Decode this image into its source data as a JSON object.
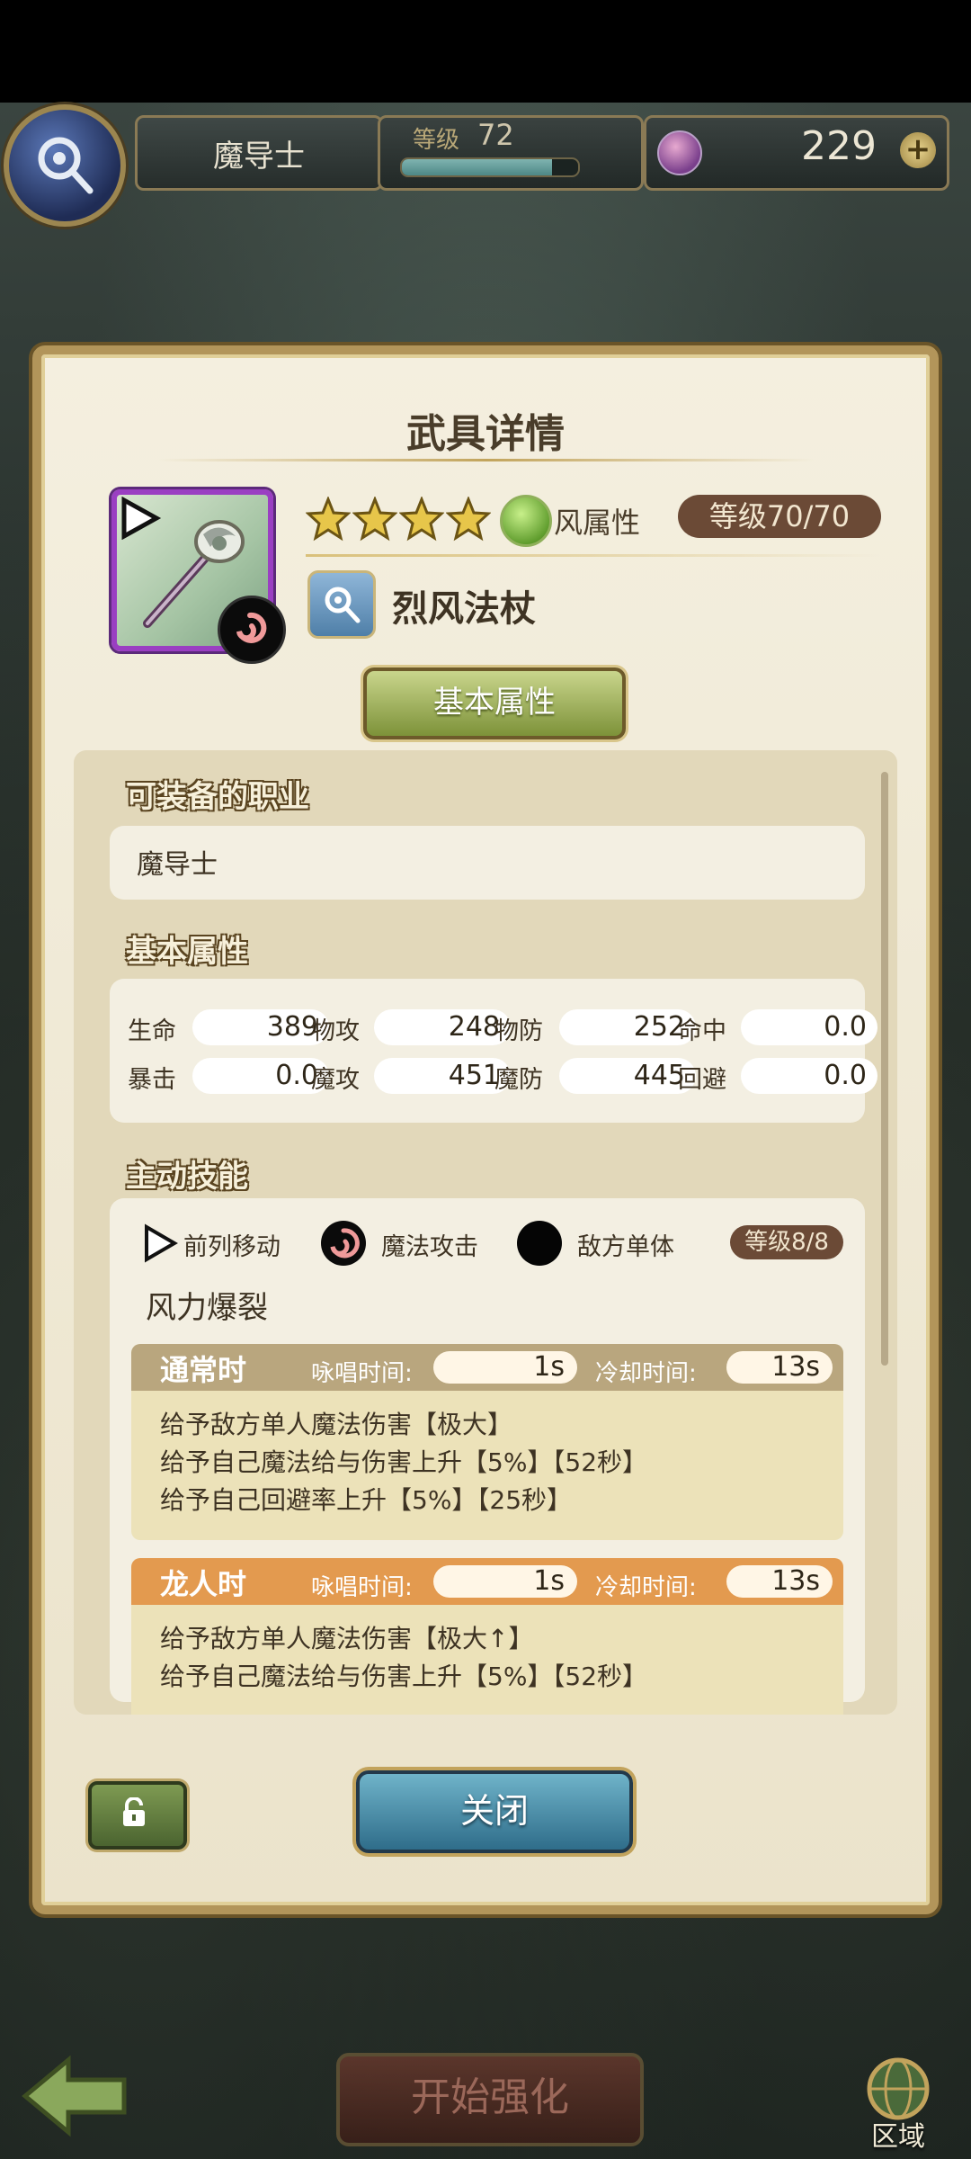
{
  "header": {
    "class_name": "魔导士",
    "level_label": "等级",
    "level_value": "72",
    "level_progress": 0.85,
    "gems": "229"
  },
  "dialog": {
    "title": "武具详情",
    "stars": 4,
    "element": "风属性",
    "level": "等级70/70",
    "weapon_name": "烈风法杖",
    "tab_label": "基本属性",
    "sections": {
      "jobs_title": "可装备的职业",
      "jobs_value": "魔导士",
      "stats_title": "基本属性",
      "skills_title": "主动技能"
    },
    "stats": [
      {
        "label": "生命",
        "value": "389"
      },
      {
        "label": "物攻",
        "value": "248"
      },
      {
        "label": "物防",
        "value": "252"
      },
      {
        "label": "命中",
        "value": "0.0"
      },
      {
        "label": "暴击",
        "value": "0.0"
      },
      {
        "label": "魔攻",
        "value": "451"
      },
      {
        "label": "魔防",
        "value": "445"
      },
      {
        "label": "回避",
        "value": "0.0"
      }
    ],
    "skill": {
      "tags": [
        "前列移动",
        "魔法攻击",
        "敌方单体"
      ],
      "level": "等级8/8",
      "name": "风力爆裂",
      "modes": [
        {
          "name": "通常时",
          "cast_label": "咏唱时间:",
          "cast_value": "1s",
          "cd_label": "冷却时间:",
          "cd_value": "13s",
          "lines": [
            "给予敌方单人魔法伤害【极大】",
            "给予自己魔法给与伤害上升【5%】【52秒】",
            "给予自己回避率上升【5%】【25秒】"
          ]
        },
        {
          "name": "龙人时",
          "cast_label": "咏唱时间:",
          "cast_value": "1s",
          "cd_label": "冷却时间:",
          "cd_value": "13s",
          "lines": [
            "给予敌方单人魔法伤害【极大↑】",
            "给予自己魔法给与伤害上升【5%】【52秒】"
          ]
        }
      ]
    },
    "close_label": "关闭"
  },
  "bottom": {
    "start_label": "开始强化",
    "region_label": "区域"
  },
  "colors": {
    "normal_header": "#b9a67e",
    "dragon_header": "#e39a4f",
    "frame_gold": "#b2955a"
  }
}
